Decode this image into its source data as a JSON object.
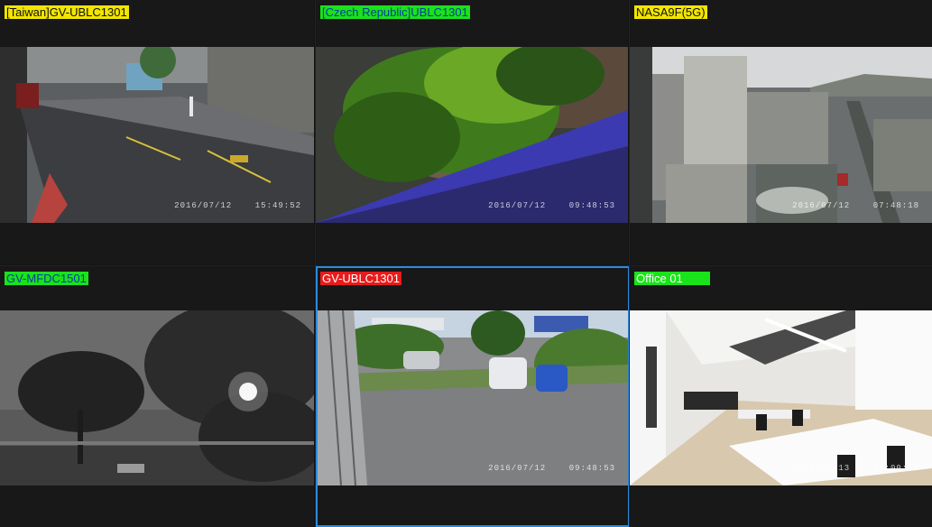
{
  "cameras": [
    {
      "label": "[Taiwan]GV-UBLC1301",
      "label_bg": "#f2e500",
      "label_fg": "#111111",
      "timestamp": "2016/07/12    15:49:52",
      "selected": false
    },
    {
      "label": "[Czech Republic]UBLC1301",
      "label_bg": "#19e319",
      "label_fg": "#0a3aa8",
      "timestamp": "2016/07/12    09:48:53",
      "selected": false
    },
    {
      "label": "NASA9F(5G)",
      "label_bg": "#f2e500",
      "label_fg": "#111111",
      "timestamp": "2016/07/12    07:48:18",
      "selected": false
    },
    {
      "label": "GV-MFDC1501",
      "label_bg": "#19e319",
      "label_fg": "#0a3aa8",
      "timestamp": "",
      "selected": false
    },
    {
      "label": "GV-UBLC1301",
      "label_bg": "#e81b1b",
      "label_fg": "#ffffff",
      "timestamp": "2016/07/12    09:48:53",
      "selected": true
    },
    {
      "label": "Office 01",
      "label_bg": "#19e319",
      "label_fg": "#ffffff",
      "timestamp": "2016/07/13    16:00:15",
      "selected": false
    }
  ],
  "colors": {
    "selection_border": "#2b8be0",
    "background": "#181818"
  }
}
